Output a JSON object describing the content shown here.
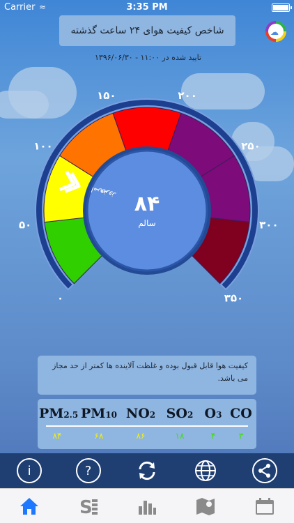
{
  "status_bar": {
    "carrier": "Carrier",
    "time": "3:35 PM"
  },
  "header": {
    "title": "شاخص کیفیت هوای ۲۴ ساعت گذشته",
    "confirm_text": "تایید شده در   ۱۱:۰۰ - ۱۳۹۶/۰۶/۳۰"
  },
  "gauge": {
    "value": 84,
    "value_label": "۸۴",
    "status_label": "سالم",
    "today_label": "امروز",
    "yesterday_label": "دیروز",
    "ticks": [
      "۰",
      "۵۰",
      "۱۰۰",
      "۱۵۰",
      "۲۰۰",
      "۲۵۰",
      "۳۰۰",
      "۳۵۰"
    ],
    "segment_colors": [
      "#2fcf00",
      "#ffff00",
      "#ff7300",
      "#ff0000",
      "#7d0b7a",
      "#7d0b7a",
      "#80001f"
    ]
  },
  "info": {
    "message": "کیفیت هوا قابل قبول بوده و غلظت آلاینده ها کمتر از حد مجاز می باشد."
  },
  "pollutants": [
    {
      "name": "PM",
      "sub": "2.5",
      "value": "۸۴",
      "color": "#f4f000"
    },
    {
      "name": "PM",
      "sub": "10",
      "value": "۶۸",
      "color": "#f4f000"
    },
    {
      "name": "NO",
      "sub": "2",
      "value": "۸۶",
      "color": "#f4f000"
    },
    {
      "name": "SO",
      "sub": "2",
      "value": "۱۸",
      "color": "#3fe000"
    },
    {
      "name": "O",
      "sub": "3",
      "value": "۴",
      "color": "#3fe000"
    },
    {
      "name": "CO",
      "sub": "",
      "value": "۳",
      "color": "#3fe000"
    }
  ],
  "toolbar": {
    "info_icon": "i",
    "help_icon": "?",
    "refresh_icon": "refresh-icon",
    "globe_icon": "globe-icon",
    "share_icon": "share-icon"
  },
  "tabs": [
    "home-icon",
    "stations-icon",
    "chart-icon",
    "map-icon",
    "calendar-icon"
  ]
}
